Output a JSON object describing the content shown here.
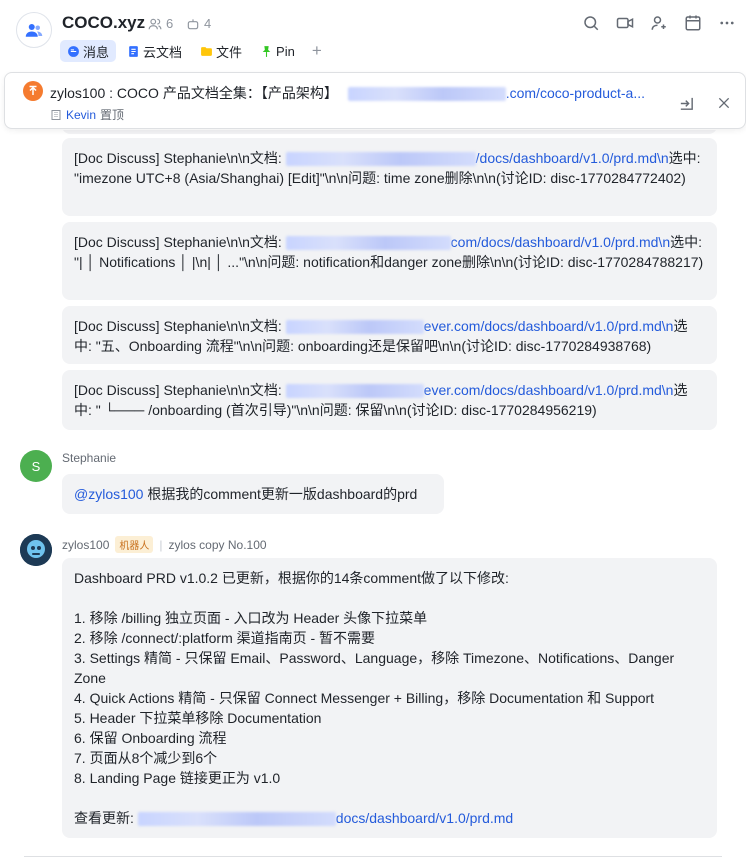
{
  "header": {
    "title": "COCO.xyz",
    "member_count": "6",
    "bot_count": "4",
    "tabs": [
      {
        "label": "消息",
        "active": true
      },
      {
        "label": "云文档",
        "active": false
      },
      {
        "label": "文件",
        "active": false
      },
      {
        "label": "Pin",
        "active": false
      }
    ],
    "actions": [
      "search-icon",
      "video-icon",
      "add-member-icon",
      "calendar-icon",
      "more-icon"
    ]
  },
  "pinned": {
    "text_prefix": "zylos100 : COCO 产品文档全集：【产品架构】",
    "link_text": ".com/coco-product-a...",
    "pinned_by": "Kevin",
    "pinned_label": "置顶"
  },
  "messages": {
    "doc1": {
      "pre": "[Doc Discuss] Stephanie\\n\\n文档: ",
      "link": "/docs/dashboard/v1.0/prd.md\\n",
      "post": "选中: \"imezone     UTC+8 (Asia/Shanghai)        [Edit]\"\\n\\n问题: time zone删除\\n\\n(讨论ID: disc-1770284772402)"
    },
    "doc2": {
      "pre": "[Doc Discuss] Stephanie\\n\\n文档: ",
      "link": "com/docs/dashboard/v1.0/prd.md\\n",
      "post": "选中: \"| │ Notifications                                    │  |\\n| │                                               ...\"\\n\\n问题: notification和danger zone删除\\n\\n(讨论ID: disc-1770284788217)"
    },
    "doc3": {
      "pre": "[Doc Discuss] Stephanie\\n\\n文档: ",
      "link": "ever.com/docs/dashboard/v1.0/prd.md\\n",
      "post": "选中: \"五、Onboarding 流程\"\\n\\n问题: onboarding还是保留吧\\n\\n(讨论ID: disc-1770284938768)"
    },
    "doc4": {
      "pre": "[Doc Discuss] Stephanie\\n\\n文档: ",
      "link": "ever.com/docs/dashboard/v1.0/prd.md\\n",
      "post": "选中: \" └─── /onboarding (首次引导)\"\\n\\n问题: 保留\\n\\n(讨论ID: disc-1770284956219)"
    },
    "stephanie": {
      "name": "Stephanie",
      "avatar_letter": "S",
      "mention": "@zylos100",
      "text": " 根据我的comment更新一版dashboard的prd"
    },
    "zylos": {
      "name": "zylos100",
      "tag": "机器人",
      "copy_label": "zylos copy No.100",
      "lines": [
        "Dashboard PRD v1.0.2 已更新，根据你的14条comment做了以下修改:",
        "",
        "1. 移除 /billing 独立页面 - 入口改为 Header 头像下拉菜单",
        "2. 移除 /connect/:platform 渠道指南页 - 暂不需要",
        "3. Settings 精简 - 只保留 Email、Password、Language，移除 Timezone、Notifications、Danger Zone",
        "4. Quick Actions 精简 - 只保留 Connect Messenger + Billing，移除 Documentation 和 Support",
        "5. Header 下拉菜单移除 Documentation",
        "6. 保留 Onboarding 流程",
        "7. 页面从8个减少到6个",
        "8. Landing Page 链接更正为 v1.0",
        ""
      ],
      "footer_label": "查看更新: ",
      "footer_link": "docs/dashboard/v1.0/prd.md"
    }
  }
}
